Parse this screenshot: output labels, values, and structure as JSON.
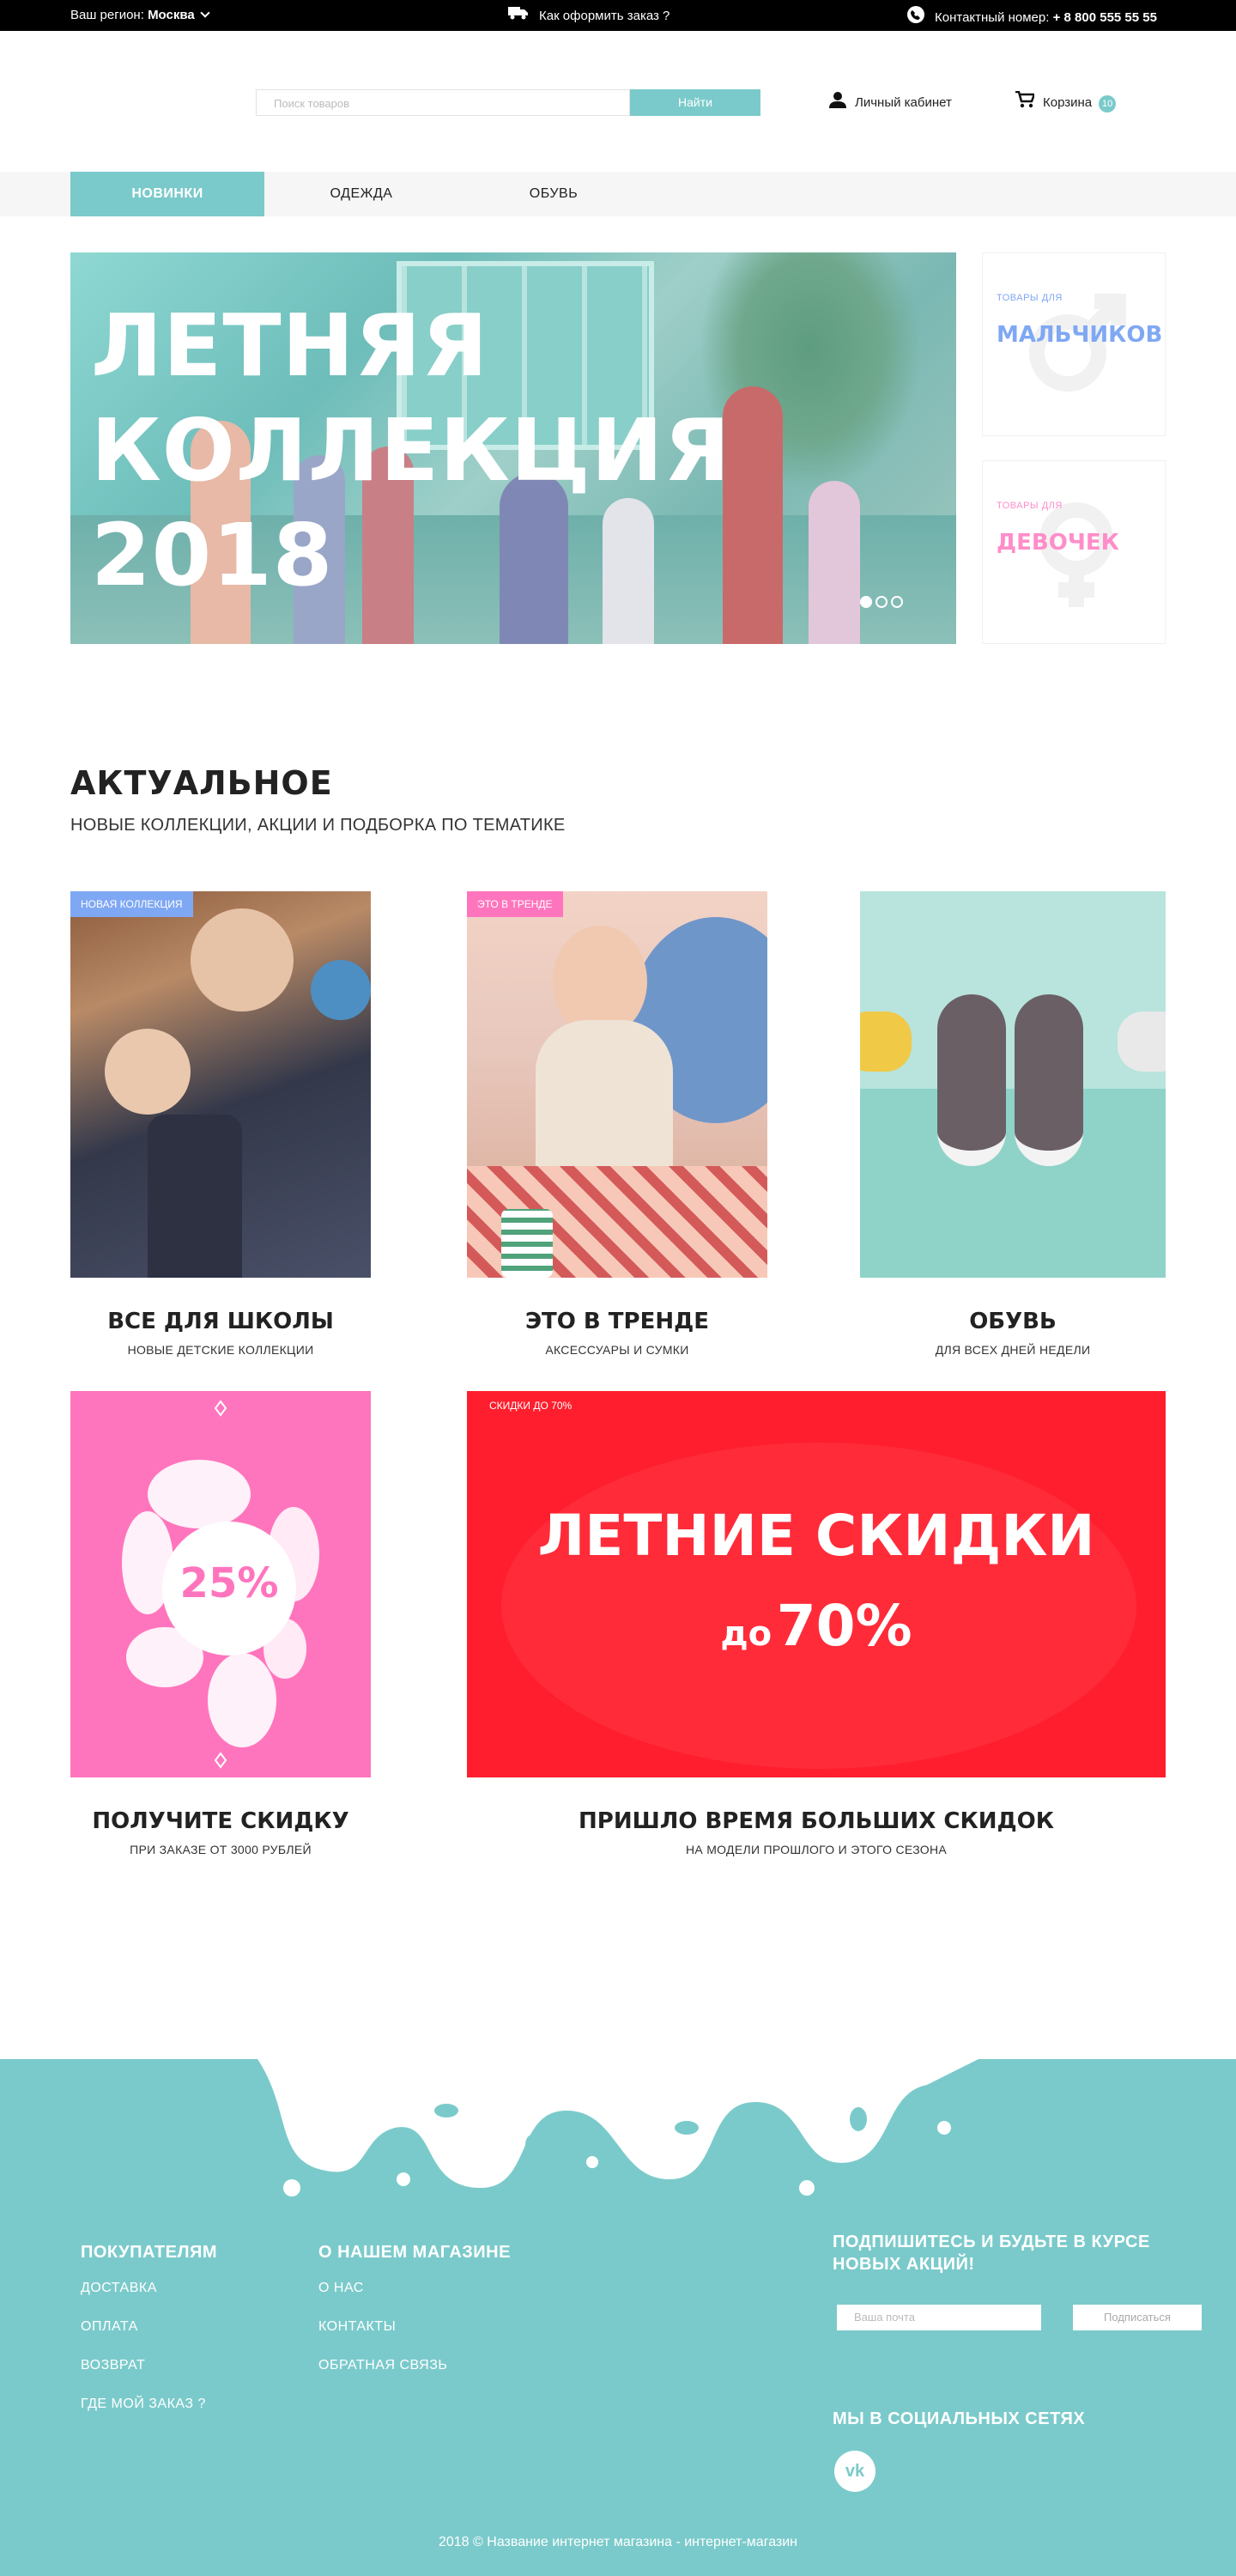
{
  "topbar": {
    "region_label": "Ваш регион:",
    "region_value": "Москва",
    "order_text": "Как оформить заказ ?",
    "contact_label": "Контактный номер:",
    "contact_phone": "+ 8 800 555 55 55"
  },
  "header": {
    "search_placeholder": "Поиск товаров",
    "search_button": "Найти",
    "account": "Личный кабинет",
    "cart": "Корзина",
    "cart_count": "10"
  },
  "nav": {
    "tabs": [
      "НОВИНКИ",
      "ОДЕЖДА",
      "ОБУВЬ"
    ],
    "active_tab": 0
  },
  "hero": {
    "title_lines": [
      "ЛЕТНЯЯ",
      "КОЛЛЕКЦИЯ",
      "2018"
    ],
    "slides_total": 3,
    "active_slide": 0
  },
  "side_banners": [
    {
      "small": "ТОВАРЫ ДЛЯ",
      "big": "МАЛЬЧИКОВ",
      "color": "#7fa8f4"
    },
    {
      "small": "ТОВАРЫ ДЛЯ",
      "big": "ДЕВОЧЕК",
      "color": "#ff8dc9"
    }
  ],
  "section": {
    "title": "АКТУАЛЬНОЕ",
    "subtitle": "НОВЫЕ КОЛЛЕКЦИИ, АКЦИИ И ПОДБОРКА ПО ТЕМАТИКЕ"
  },
  "cards": [
    {
      "tag": "НОВАЯ КОЛЛЕКЦИЯ",
      "tag_color": "#7fa8f4",
      "title": "ВСЕ ДЛЯ ШКОЛЫ",
      "subtitle": "НОВЫЕ ДЕТСКИЕ КОЛЛЕКЦИИ"
    },
    {
      "tag": "ЭТО В ТРЕНДЕ",
      "tag_color": "#ff75bd",
      "title": "ЭТО В ТРЕНДЕ",
      "subtitle": "АКСЕССУАРЫ И СУМКИ"
    },
    {
      "tag": "",
      "tag_color": "",
      "title": "ОБУВЬ",
      "subtitle": "ДЛЯ ВСЕХ ДНЕЙ НЕДЕЛИ"
    }
  ],
  "promos": {
    "discount_pct": "25%",
    "discount_title": "ПОЛУЧИТЕ СКИДКУ",
    "discount_sub": "ПРИ ЗАКАЗЕ ОТ 3000 РУБЛЕЙ",
    "sale_small": "СКИДКИ ДО 70%",
    "sale_big": "ЛЕТНИЕ СКИДКИ",
    "sale_prefix": "до",
    "sale_pct": "70%",
    "sale_title": "ПРИШЛО ВРЕМЯ БОЛЬШИХ СКИДОК",
    "sale_sub": "НА МОДЕЛИ ПРОШЛОГО И ЭТОГО СЕЗОНА"
  },
  "footer": {
    "col1_title": "ПОКУПАТЕЛЯМ",
    "col1_links": [
      "ДОСТАВКА",
      "ОПЛАТА",
      "ВОЗВРАТ",
      "ГДЕ МОЙ ЗАКАЗ ?"
    ],
    "col2_title": "О НАШЕМ МАГАЗИНЕ",
    "col2_links": [
      "О НАС",
      "КОНТАКТЫ",
      "ОБРАТНАЯ СВЯЗЬ"
    ],
    "subscribe_title": "ПОДПИШИТЕСЬ И БУДЬТЕ В КУРСЕ НОВЫХ АКЦИЙ!",
    "email_placeholder": "Ваша почта",
    "subscribe_button": "Подписаться",
    "social_title": "МЫ В СОЦИАЛЬНЫХ СЕТЯХ",
    "vk_icon": "vk-icon",
    "copyright": "2018 © Название интернет магазина - интернет-магазин"
  },
  "colors": {
    "accent": "#7bcacb",
    "pink": "#ff75bd",
    "red": "#ff1e2d",
    "blue": "#7fa8f4"
  }
}
